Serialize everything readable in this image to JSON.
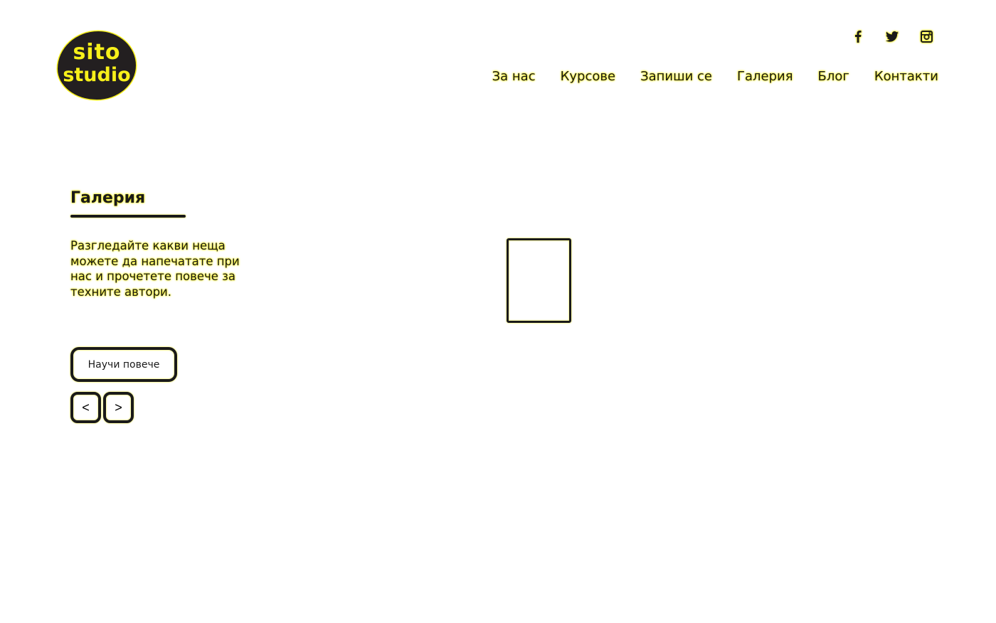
{
  "brand": {
    "logo_line1": "sito",
    "logo_line2": "studio"
  },
  "social": [
    {
      "icon": "facebook-icon"
    },
    {
      "icon": "twitter-icon"
    },
    {
      "icon": "instagram-icon"
    }
  ],
  "nav": {
    "items": [
      "За нас",
      "Курсове",
      "Запиши се",
      "Галерия",
      "Блог",
      "Контакти"
    ]
  },
  "section": {
    "title": "Галерия",
    "description": "Разгледайте какви неща можете да напечатате при нас и прочетете повече за техните автори.",
    "more_button": "Научи повече",
    "prev_label": "<",
    "next_label": ">"
  },
  "colors": {
    "accent_glow": "#f7f01a",
    "ink": "#1a1a1a",
    "logo_bg": "#231f20"
  }
}
